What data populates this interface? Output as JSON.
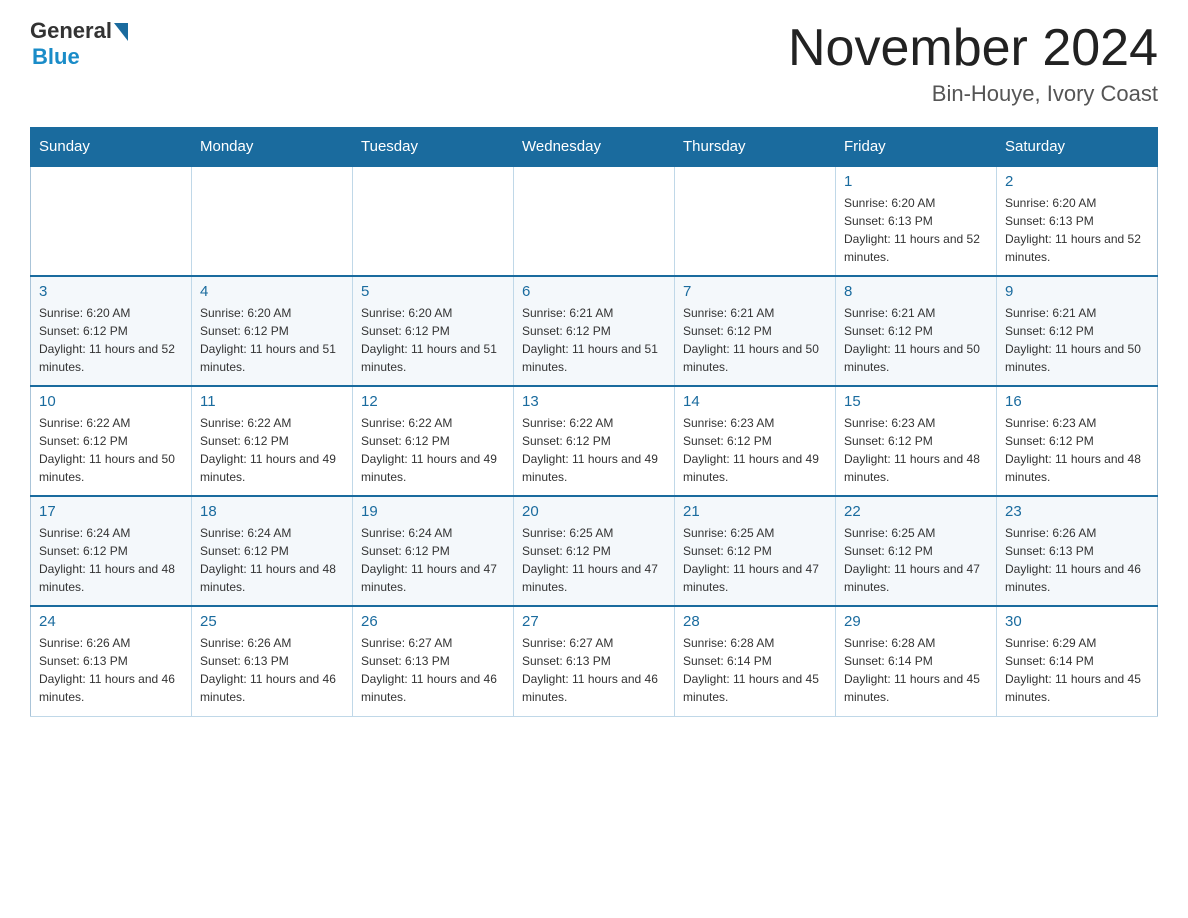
{
  "logo": {
    "general": "General",
    "blue": "Blue"
  },
  "header": {
    "month_year": "November 2024",
    "location": "Bin-Houye, Ivory Coast"
  },
  "weekdays": [
    "Sunday",
    "Monday",
    "Tuesday",
    "Wednesday",
    "Thursday",
    "Friday",
    "Saturday"
  ],
  "weeks": [
    [
      {
        "day": "",
        "sunrise": "",
        "sunset": "",
        "daylight": ""
      },
      {
        "day": "",
        "sunrise": "",
        "sunset": "",
        "daylight": ""
      },
      {
        "day": "",
        "sunrise": "",
        "sunset": "",
        "daylight": ""
      },
      {
        "day": "",
        "sunrise": "",
        "sunset": "",
        "daylight": ""
      },
      {
        "day": "",
        "sunrise": "",
        "sunset": "",
        "daylight": ""
      },
      {
        "day": "1",
        "sunrise": "Sunrise: 6:20 AM",
        "sunset": "Sunset: 6:13 PM",
        "daylight": "Daylight: 11 hours and 52 minutes."
      },
      {
        "day": "2",
        "sunrise": "Sunrise: 6:20 AM",
        "sunset": "Sunset: 6:13 PM",
        "daylight": "Daylight: 11 hours and 52 minutes."
      }
    ],
    [
      {
        "day": "3",
        "sunrise": "Sunrise: 6:20 AM",
        "sunset": "Sunset: 6:12 PM",
        "daylight": "Daylight: 11 hours and 52 minutes."
      },
      {
        "day": "4",
        "sunrise": "Sunrise: 6:20 AM",
        "sunset": "Sunset: 6:12 PM",
        "daylight": "Daylight: 11 hours and 51 minutes."
      },
      {
        "day": "5",
        "sunrise": "Sunrise: 6:20 AM",
        "sunset": "Sunset: 6:12 PM",
        "daylight": "Daylight: 11 hours and 51 minutes."
      },
      {
        "day": "6",
        "sunrise": "Sunrise: 6:21 AM",
        "sunset": "Sunset: 6:12 PM",
        "daylight": "Daylight: 11 hours and 51 minutes."
      },
      {
        "day": "7",
        "sunrise": "Sunrise: 6:21 AM",
        "sunset": "Sunset: 6:12 PM",
        "daylight": "Daylight: 11 hours and 50 minutes."
      },
      {
        "day": "8",
        "sunrise": "Sunrise: 6:21 AM",
        "sunset": "Sunset: 6:12 PM",
        "daylight": "Daylight: 11 hours and 50 minutes."
      },
      {
        "day": "9",
        "sunrise": "Sunrise: 6:21 AM",
        "sunset": "Sunset: 6:12 PM",
        "daylight": "Daylight: 11 hours and 50 minutes."
      }
    ],
    [
      {
        "day": "10",
        "sunrise": "Sunrise: 6:22 AM",
        "sunset": "Sunset: 6:12 PM",
        "daylight": "Daylight: 11 hours and 50 minutes."
      },
      {
        "day": "11",
        "sunrise": "Sunrise: 6:22 AM",
        "sunset": "Sunset: 6:12 PM",
        "daylight": "Daylight: 11 hours and 49 minutes."
      },
      {
        "day": "12",
        "sunrise": "Sunrise: 6:22 AM",
        "sunset": "Sunset: 6:12 PM",
        "daylight": "Daylight: 11 hours and 49 minutes."
      },
      {
        "day": "13",
        "sunrise": "Sunrise: 6:22 AM",
        "sunset": "Sunset: 6:12 PM",
        "daylight": "Daylight: 11 hours and 49 minutes."
      },
      {
        "day": "14",
        "sunrise": "Sunrise: 6:23 AM",
        "sunset": "Sunset: 6:12 PM",
        "daylight": "Daylight: 11 hours and 49 minutes."
      },
      {
        "day": "15",
        "sunrise": "Sunrise: 6:23 AM",
        "sunset": "Sunset: 6:12 PM",
        "daylight": "Daylight: 11 hours and 48 minutes."
      },
      {
        "day": "16",
        "sunrise": "Sunrise: 6:23 AM",
        "sunset": "Sunset: 6:12 PM",
        "daylight": "Daylight: 11 hours and 48 minutes."
      }
    ],
    [
      {
        "day": "17",
        "sunrise": "Sunrise: 6:24 AM",
        "sunset": "Sunset: 6:12 PM",
        "daylight": "Daylight: 11 hours and 48 minutes."
      },
      {
        "day": "18",
        "sunrise": "Sunrise: 6:24 AM",
        "sunset": "Sunset: 6:12 PM",
        "daylight": "Daylight: 11 hours and 48 minutes."
      },
      {
        "day": "19",
        "sunrise": "Sunrise: 6:24 AM",
        "sunset": "Sunset: 6:12 PM",
        "daylight": "Daylight: 11 hours and 47 minutes."
      },
      {
        "day": "20",
        "sunrise": "Sunrise: 6:25 AM",
        "sunset": "Sunset: 6:12 PM",
        "daylight": "Daylight: 11 hours and 47 minutes."
      },
      {
        "day": "21",
        "sunrise": "Sunrise: 6:25 AM",
        "sunset": "Sunset: 6:12 PM",
        "daylight": "Daylight: 11 hours and 47 minutes."
      },
      {
        "day": "22",
        "sunrise": "Sunrise: 6:25 AM",
        "sunset": "Sunset: 6:12 PM",
        "daylight": "Daylight: 11 hours and 47 minutes."
      },
      {
        "day": "23",
        "sunrise": "Sunrise: 6:26 AM",
        "sunset": "Sunset: 6:13 PM",
        "daylight": "Daylight: 11 hours and 46 minutes."
      }
    ],
    [
      {
        "day": "24",
        "sunrise": "Sunrise: 6:26 AM",
        "sunset": "Sunset: 6:13 PM",
        "daylight": "Daylight: 11 hours and 46 minutes."
      },
      {
        "day": "25",
        "sunrise": "Sunrise: 6:26 AM",
        "sunset": "Sunset: 6:13 PM",
        "daylight": "Daylight: 11 hours and 46 minutes."
      },
      {
        "day": "26",
        "sunrise": "Sunrise: 6:27 AM",
        "sunset": "Sunset: 6:13 PM",
        "daylight": "Daylight: 11 hours and 46 minutes."
      },
      {
        "day": "27",
        "sunrise": "Sunrise: 6:27 AM",
        "sunset": "Sunset: 6:13 PM",
        "daylight": "Daylight: 11 hours and 46 minutes."
      },
      {
        "day": "28",
        "sunrise": "Sunrise: 6:28 AM",
        "sunset": "Sunset: 6:14 PM",
        "daylight": "Daylight: 11 hours and 45 minutes."
      },
      {
        "day": "29",
        "sunrise": "Sunrise: 6:28 AM",
        "sunset": "Sunset: 6:14 PM",
        "daylight": "Daylight: 11 hours and 45 minutes."
      },
      {
        "day": "30",
        "sunrise": "Sunrise: 6:29 AM",
        "sunset": "Sunset: 6:14 PM",
        "daylight": "Daylight: 11 hours and 45 minutes."
      }
    ]
  ]
}
